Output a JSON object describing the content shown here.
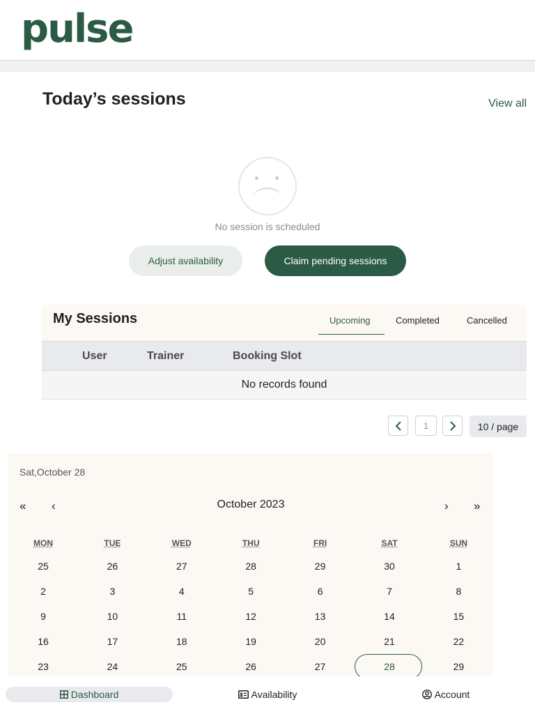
{
  "app": {
    "logo": "pulse",
    "accent": "#2b5a45"
  },
  "today": {
    "title": "Today’s sessions",
    "view_all": "View all",
    "empty_icon": "sad-face-icon",
    "empty_text": "No session is scheduled",
    "adjust_label": "Adjust availability",
    "claim_label": "Claim pending sessions"
  },
  "my_sessions": {
    "title": "My Sessions",
    "tabs": [
      "Upcoming",
      "Completed",
      "Cancelled"
    ],
    "active_tab": "Upcoming",
    "columns": [
      "User",
      "Trainer",
      "Booking Slot"
    ],
    "empty": "No records found"
  },
  "pagination": {
    "page": "1",
    "page_size": "10 / page"
  },
  "calendar": {
    "selected_label": "Sat,October 28",
    "month_label": "October 2023",
    "nav": {
      "prev_year": "«",
      "prev_month": "‹",
      "next_month": "›",
      "next_year": "»"
    },
    "weekdays": [
      "MON",
      "TUE",
      "WED",
      "THU",
      "FRI",
      "SAT",
      "SUN"
    ],
    "weeks": [
      [
        "25",
        "26",
        "27",
        "28",
        "29",
        "30",
        "1"
      ],
      [
        "2",
        "3",
        "4",
        "5",
        "6",
        "7",
        "8"
      ],
      [
        "9",
        "10",
        "11",
        "12",
        "13",
        "14",
        "15"
      ],
      [
        "16",
        "17",
        "18",
        "19",
        "20",
        "21",
        "22"
      ],
      [
        "23",
        "24",
        "25",
        "26",
        "27",
        "28",
        "29"
      ]
    ],
    "selected_day": "28"
  },
  "bottom_nav": {
    "items": [
      {
        "label": "Dashboard",
        "icon": "grid-icon"
      },
      {
        "label": "Availability",
        "icon": "id-card-icon"
      },
      {
        "label": "Account",
        "icon": "user-circle-icon"
      }
    ],
    "active": "Dashboard"
  }
}
